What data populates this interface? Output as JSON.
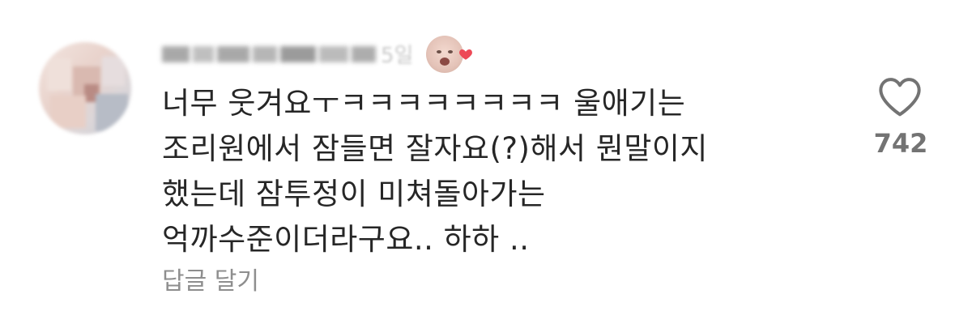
{
  "comment": {
    "time_ago": "5일",
    "text_lines": [
      "너무 웃겨요ㅜㅋㅋㅋㅋㅋㅋㅋㅋ 울애기는",
      "조리원에서 잠들면 잘자요(?)해서 뭔말이지",
      "했는데 잠투정이 미쳐돌아가는",
      "억까수준이더라구요.. 하하 .."
    ],
    "reply_label": "답글 달기",
    "like_count": "742",
    "like_icon": "heart-outline-icon",
    "author_liked_badge": "red-heart-icon"
  },
  "colors": {
    "text": "#262626",
    "secondary": "#8e8e8e",
    "count": "#737373",
    "heart_badge": "#ed4956"
  }
}
